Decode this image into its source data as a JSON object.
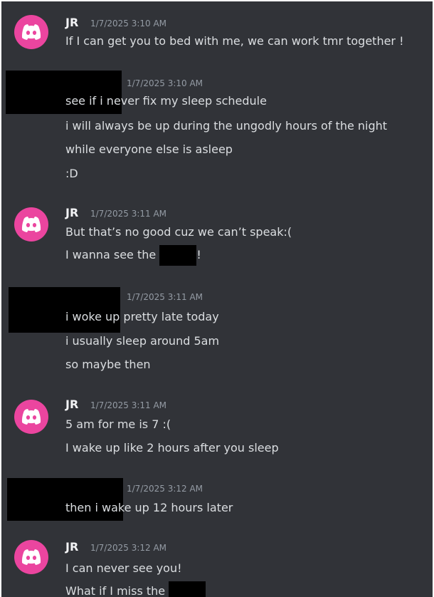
{
  "messages": [
    {
      "author": "JR",
      "timestamp": "1/7/2025 3:10 AM",
      "lines": [
        "If I can get you to bed with me, we can work tmr together !"
      ]
    },
    {
      "author": "",
      "timestamp": "1/7/2025 3:10 AM",
      "lines": [
        "see if i never fix my sleep schedule",
        "i will always be up during the ungodly hours of the night",
        "while everyone else is asleep",
        ":D"
      ]
    },
    {
      "author": "JR",
      "timestamp": "1/7/2025 3:11 AM",
      "lines": [
        "But that’s no good cuz we can’t speak:("
      ],
      "line2_before": "I wanna see the ",
      "line2_after": "!"
    },
    {
      "author": "",
      "timestamp": "1/7/2025 3:11 AM",
      "lines": [
        "i woke up pretty late today",
        "i usually sleep around 5am",
        "so maybe then"
      ]
    },
    {
      "author": "JR",
      "timestamp": "1/7/2025 3:11 AM",
      "lines": [
        "5 am for me is 7 :(",
        "I wake up like 2 hours after you sleep"
      ]
    },
    {
      "author": "",
      "timestamp": "1/7/2025 3:12 AM",
      "lines": [
        "then i wake up 12 hours later"
      ]
    },
    {
      "author": "JR",
      "timestamp": "1/7/2025 3:12 AM",
      "lines": [
        "I can never see you!"
      ],
      "line2_before": "What if I miss the "
    }
  ],
  "colors": {
    "background": "#313338",
    "avatar": "#eb459f",
    "username": "#f2f3f5",
    "timestamp": "#949ba4",
    "message_text": "#dbdee1",
    "redaction": "#000000"
  },
  "icons": {
    "avatar_icon": "discord-logo-icon"
  }
}
